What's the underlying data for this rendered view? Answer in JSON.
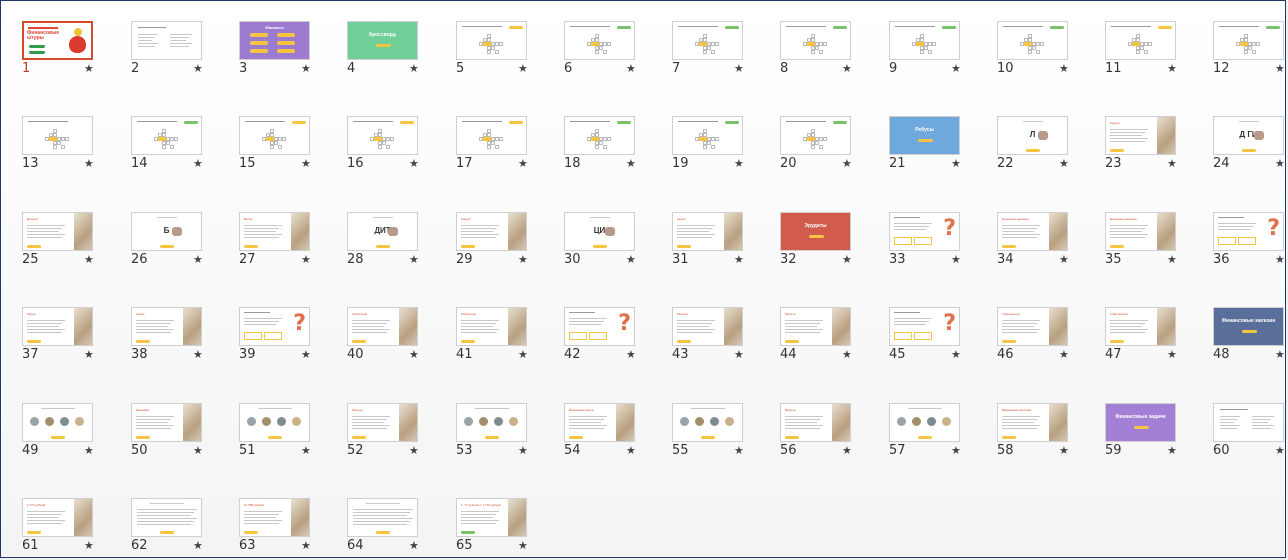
{
  "slides": [
    {
      "num": "1",
      "kind": "title-red",
      "title": "Финансовые штуры",
      "selected": true
    },
    {
      "num": "2",
      "kind": "text2"
    },
    {
      "num": "3",
      "kind": "purple-grid",
      "title": "Финансы"
    },
    {
      "num": "4",
      "kind": "green-title",
      "title": "Кроссворд"
    },
    {
      "num": "5",
      "kind": "crossword",
      "tag": "yellow"
    },
    {
      "num": "6",
      "kind": "crossword",
      "tag": "green"
    },
    {
      "num": "7",
      "kind": "crossword",
      "tag": "green"
    },
    {
      "num": "8",
      "kind": "crossword",
      "tag": "green"
    },
    {
      "num": "9",
      "kind": "crossword",
      "tag": "green"
    },
    {
      "num": "10",
      "kind": "crossword",
      "tag": "green"
    },
    {
      "num": "11",
      "kind": "crossword",
      "tag": "yellow"
    },
    {
      "num": "12",
      "kind": "crossword",
      "tag": "green"
    },
    {
      "num": "13",
      "kind": "crossword",
      "tag": "none"
    },
    {
      "num": "14",
      "kind": "crossword",
      "tag": "green"
    },
    {
      "num": "15",
      "kind": "crossword",
      "tag": "yellow"
    },
    {
      "num": "16",
      "kind": "crossword",
      "tag": "yellow"
    },
    {
      "num": "17",
      "kind": "crossword",
      "tag": "yellow"
    },
    {
      "num": "18",
      "kind": "crossword",
      "tag": "green"
    },
    {
      "num": "19",
      "kind": "crossword",
      "tag": "green"
    },
    {
      "num": "20",
      "kind": "crossword",
      "tag": "green"
    },
    {
      "num": "21",
      "kind": "blue-title",
      "title": "Ребусы"
    },
    {
      "num": "22",
      "kind": "rebus",
      "text": "Л"
    },
    {
      "num": "23",
      "kind": "text-photo",
      "title": "Кредит"
    },
    {
      "num": "24",
      "kind": "rebus",
      "text": "Д ГИ"
    },
    {
      "num": "25",
      "kind": "text-photo",
      "title": "Депозит"
    },
    {
      "num": "26",
      "kind": "rebus",
      "text": "Б"
    },
    {
      "num": "27",
      "kind": "text-photo",
      "title": "Вклад"
    },
    {
      "num": "28",
      "kind": "rebus",
      "text": "ДИТ"
    },
    {
      "num": "29",
      "kind": "text-photo",
      "title": "Кредит"
    },
    {
      "num": "30",
      "kind": "rebus",
      "text": "ЦИ"
    },
    {
      "num": "31",
      "kind": "text-photo",
      "title": "Акция"
    },
    {
      "num": "32",
      "kind": "red-title",
      "title": "Эрудиты"
    },
    {
      "num": "33",
      "kind": "question"
    },
    {
      "num": "34",
      "kind": "text-photo",
      "title": "Денежная единица"
    },
    {
      "num": "35",
      "kind": "text-photo",
      "title": "Денежная единица"
    },
    {
      "num": "36",
      "kind": "question"
    },
    {
      "num": "37",
      "kind": "text-photo",
      "title": "Акция"
    },
    {
      "num": "38",
      "kind": "text-photo",
      "title": "Акция"
    },
    {
      "num": "39",
      "kind": "question"
    },
    {
      "num": "40",
      "kind": "text-photo",
      "title": "Облигация"
    },
    {
      "num": "41",
      "kind": "text-photo",
      "title": "Облигация"
    },
    {
      "num": "42",
      "kind": "question"
    },
    {
      "num": "43",
      "kind": "text-photo",
      "title": "Монета"
    },
    {
      "num": "44",
      "kind": "text-photo",
      "title": "Монета"
    },
    {
      "num": "45",
      "kind": "question"
    },
    {
      "num": "46",
      "kind": "text-photo",
      "title": "Сбережения"
    },
    {
      "num": "47",
      "kind": "text-photo",
      "title": "Сбережения"
    },
    {
      "num": "48",
      "kind": "navy-title",
      "title": "Финансовые магазин"
    },
    {
      "num": "49",
      "kind": "coins"
    },
    {
      "num": "50",
      "kind": "text-photo",
      "title": "Банкомат"
    },
    {
      "num": "51",
      "kind": "coins"
    },
    {
      "num": "52",
      "kind": "text-photo",
      "title": "Монеты"
    },
    {
      "num": "53",
      "kind": "coins"
    },
    {
      "num": "54",
      "kind": "text-photo",
      "title": "Банковская карта"
    },
    {
      "num": "55",
      "kind": "coins"
    },
    {
      "num": "56",
      "kind": "text-photo",
      "title": "Валюта"
    },
    {
      "num": "57",
      "kind": "coins"
    },
    {
      "num": "58",
      "kind": "text-photo",
      "title": "Банковская карточка"
    },
    {
      "num": "59",
      "kind": "purple-title",
      "title": "Финансовые задачи"
    },
    {
      "num": "60",
      "kind": "text2"
    },
    {
      "num": "61",
      "kind": "text-photo",
      "title": "1 770 рублей"
    },
    {
      "num": "62",
      "kind": "text-long"
    },
    {
      "num": "63",
      "kind": "text-photo",
      "title": "10 955 рублей"
    },
    {
      "num": "64",
      "kind": "text-long"
    },
    {
      "num": "65",
      "kind": "text-photo-green",
      "title": "1. 77 рублей 2. 1 770 рублей"
    }
  ],
  "star_glyph": "★",
  "colors": {
    "selected_border": "#d34b2c",
    "red": "#e2463b",
    "purple": "#9d7bd1",
    "green": "#6fcf97",
    "blue": "#6fa8dc",
    "rust": "#d15b4d",
    "navy": "#5a6e9a",
    "purple2": "#a47fd6",
    "yellow": "#f5c542"
  }
}
